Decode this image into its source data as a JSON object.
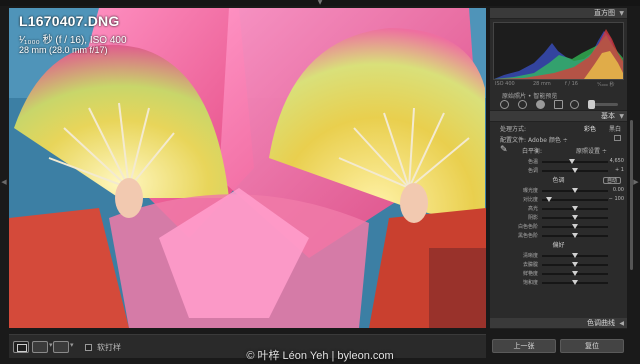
{
  "top_toggle_icon": "triangle-down",
  "side_toggle_icon": "triangle-left",
  "photo": {
    "filename": "L1670407.DNG",
    "exposure": "¹⁄₁₀₀₀ 秒 (f / 16), ISO 400",
    "lens": "28 mm (28.0 mm f/17)"
  },
  "toolbar": {
    "proof_label": "软打样",
    "buttons": [
      "loupe-view",
      "compare-view",
      "survey-view"
    ]
  },
  "watermark": "© 叶梓 Léon Yeh | byleon.com",
  "panel": {
    "histogram_title": "直方图",
    "histogram_meta": [
      "ISO 400",
      "28 mm",
      "f / 16",
      "¹⁄₁₀₀₀ 秒"
    ],
    "tools_label": "原始照片 • 智能预览",
    "basic_title": "基本",
    "treatment_label": "处理方式:",
    "treatment_color": "彩色",
    "treatment_bw": "黑白",
    "profile_label": "配置文件:",
    "profile_value": "Adobe 颜色 ÷",
    "wb_label": "白平衡:",
    "wb_value": "原照设置 ÷",
    "wb_sliders": [
      {
        "label": "色温",
        "value": "4,650",
        "pos": 0.45
      },
      {
        "label": "色调",
        "value": "+ 1",
        "pos": 0.5
      }
    ],
    "tone_label": "色调",
    "tone_auto": "自动",
    "tone_sliders": [
      {
        "label": "曝光度",
        "value": "0.00",
        "pos": 0.5
      },
      {
        "label": "对比度",
        "value": "− 100",
        "pos": 0.1
      },
      {
        "label": "高光",
        "value": "",
        "pos": 0.5
      },
      {
        "label": "阴影",
        "value": "",
        "pos": 0.5
      },
      {
        "label": "白色色阶",
        "value": "",
        "pos": 0.5
      },
      {
        "label": "黑色色阶",
        "value": "",
        "pos": 0.5
      }
    ],
    "presence_label": "偏好",
    "presence_sliders": [
      {
        "label": "清晰度",
        "value": "",
        "pos": 0.5
      },
      {
        "label": "去朦胧",
        "value": "",
        "pos": 0.5
      },
      {
        "label": "鲜艳度",
        "value": "",
        "pos": 0.5
      },
      {
        "label": "饱和度",
        "value": "",
        "pos": 0.5
      }
    ],
    "curve_title": "色调曲线",
    "prev_button": "上一张",
    "reset_button": "复位"
  }
}
